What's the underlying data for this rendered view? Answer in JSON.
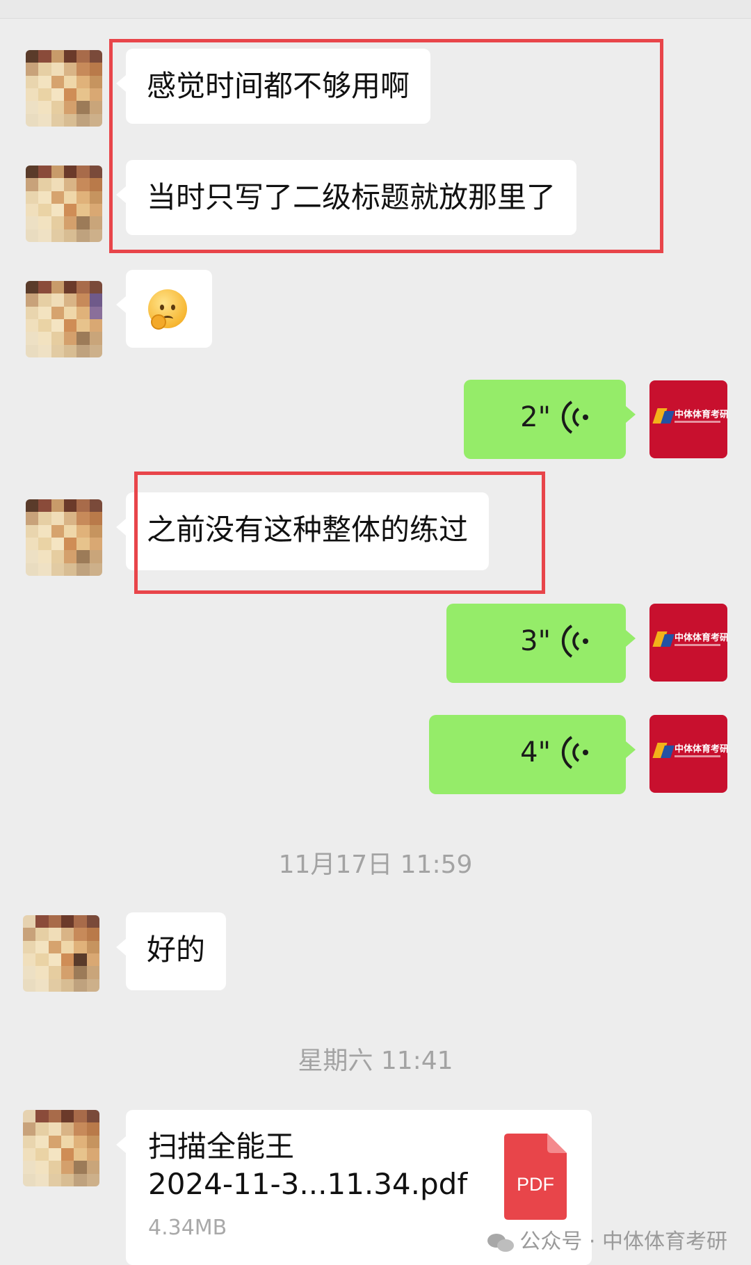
{
  "messages": [
    {
      "type": "text",
      "side": "left",
      "text": "感觉时间都不够用啊"
    },
    {
      "type": "text",
      "side": "left",
      "text": "当时只写了二级标题就放那里了"
    },
    {
      "type": "emoji",
      "side": "left",
      "emoji": "worried-face-emoji"
    },
    {
      "type": "voice",
      "side": "right",
      "duration": "2\""
    },
    {
      "type": "text",
      "side": "left",
      "text": "之前没有这种整体的练过"
    },
    {
      "type": "voice",
      "side": "right",
      "duration": "3\""
    },
    {
      "type": "voice",
      "side": "right",
      "duration": "4\""
    },
    {
      "type": "text",
      "side": "left",
      "text": "好的"
    },
    {
      "type": "file",
      "side": "left",
      "name_line1": "扫描全能王",
      "name_line2": "2024-11-3...11.34.pdf",
      "size": "4.34MB",
      "icon_label": "PDF"
    }
  ],
  "timestamps": [
    "11月17日 11:59",
    "星期六 11:41"
  ],
  "brand_avatar": {
    "text": "中体体育考研"
  },
  "watermark": {
    "text": "公众号 · 中体体育考研",
    "icon": "wechat-icon"
  },
  "colors": {
    "bubble_right": "#95ec69",
    "highlight_box": "#e8454a",
    "brand": "#c8102e",
    "background": "#ededed"
  }
}
